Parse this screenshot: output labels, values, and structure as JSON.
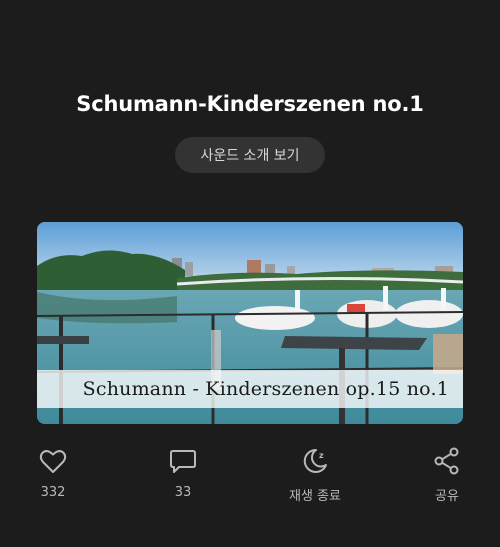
{
  "title": "Schumann-Kinderszenen no.1",
  "intro_button": "사운드 소개 보기",
  "thumbnail": {
    "caption": "Schumann - Kinderszenen op.15 no.1"
  },
  "actions": {
    "like": {
      "icon": "heart-icon",
      "count": "332"
    },
    "comment": {
      "icon": "comment-icon",
      "count": "33"
    },
    "sleep_timer": {
      "icon": "moon-icon",
      "label": "재생 종료"
    },
    "share": {
      "icon": "share-icon",
      "label": "공유"
    }
  },
  "colors": {
    "background": "#1c1c1c",
    "button_bg": "#333333",
    "label": "#b9b9b9"
  }
}
